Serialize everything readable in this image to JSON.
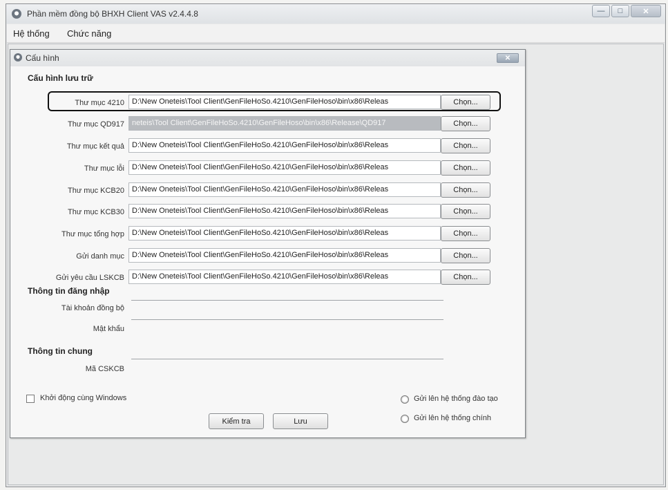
{
  "window": {
    "title": "Phần mềm đồng bộ BHXH Client VAS v2.4.4.8"
  },
  "menu": {
    "items": [
      "Hệ thống",
      "Chức năng"
    ]
  },
  "dialog": {
    "title": "Cấu hình",
    "storage_section": "Cấu hình lưu trữ",
    "folders": [
      {
        "label": "Thư mục 4210",
        "path": "D:\\New Oneteis\\Tool Client\\GenFileHoSo.4210\\GenFileHoso\\bin\\x86\\Releas",
        "button": "Chọn..."
      },
      {
        "label": "Thư mục QD917",
        "path": "neteis\\Tool Client\\GenFileHoSo.4210\\GenFileHoso\\bin\\x86\\Release\\QD917",
        "button": "Chọn..."
      },
      {
        "label": "Thư mục kết quả",
        "path": "D:\\New Oneteis\\Tool Client\\GenFileHoSo.4210\\GenFileHoso\\bin\\x86\\Releas",
        "button": "Chọn..."
      },
      {
        "label": "Thư mục lỗi",
        "path": "D:\\New Oneteis\\Tool Client\\GenFileHoSo.4210\\GenFileHoso\\bin\\x86\\Releas",
        "button": "Chọn..."
      },
      {
        "label": "Thư mục KCB20",
        "path": "D:\\New Oneteis\\Tool Client\\GenFileHoSo.4210\\GenFileHoso\\bin\\x86\\Releas",
        "button": "Chọn..."
      },
      {
        "label": "Thư mục KCB30",
        "path": "D:\\New Oneteis\\Tool Client\\GenFileHoSo.4210\\GenFileHoso\\bin\\x86\\Releas",
        "button": "Chọn..."
      },
      {
        "label": "Thư mục tổng hợp",
        "path": "D:\\New Oneteis\\Tool Client\\GenFileHoSo.4210\\GenFileHoso\\bin\\x86\\Releas",
        "button": "Chọn..."
      },
      {
        "label": "Gửi danh mục",
        "path": "D:\\New Oneteis\\Tool Client\\GenFileHoSo.4210\\GenFileHoso\\bin\\x86\\Releas",
        "button": "Chọn..."
      },
      {
        "label": "Gửi yêu cầu LSKCB",
        "path": "D:\\New Oneteis\\Tool Client\\GenFileHoSo.4210\\GenFileHoso\\bin\\x86\\Releas",
        "button": "Chọn..."
      }
    ],
    "login_section": "Thông tin đăng nhập",
    "sync_account_label": "Tài khoản đồng bộ",
    "sync_account_value": "",
    "password_label": "Mật khẩu",
    "password_value": "",
    "general_section": "Thông tin chung",
    "cskcb_label": "Mã CSKCB",
    "cskcb_value": "",
    "startup_label": "Khởi động cùng Windows",
    "radio_training": "Gửi lên hệ thống đào tạo",
    "radio_main": "Gửi lên hệ thống chính",
    "check_button": "Kiểm tra",
    "save_button": "Lưu"
  }
}
